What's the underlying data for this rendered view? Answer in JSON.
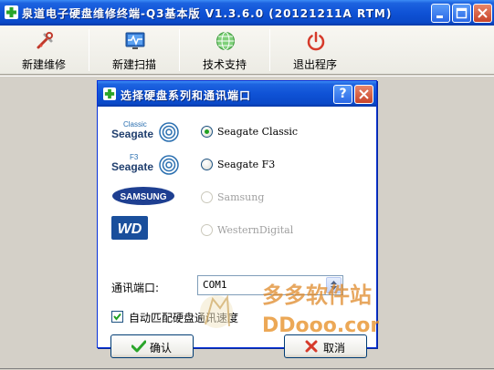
{
  "window": {
    "title": "泉道电子硬盘维修终端-Q3基本版  V1.3.6.0  (20121211A RTM)"
  },
  "toolbar": {
    "items": [
      {
        "label": "新建维修",
        "icon": "wrench-icon"
      },
      {
        "label": "新建扫描",
        "icon": "monitor-scan-icon"
      },
      {
        "label": "技术支持",
        "icon": "globe-icon"
      },
      {
        "label": "退出程序",
        "icon": "power-icon"
      }
    ]
  },
  "dialog": {
    "title": "选择硬盘系列和通讯端口",
    "help": "?",
    "series": [
      {
        "logo_text": "Seagate",
        "logo_sub": "Classic",
        "label": "Seagate Classic",
        "selected": true,
        "enabled": true
      },
      {
        "logo_text": "Seagate",
        "logo_sub": "F3",
        "label": "Seagate F3",
        "selected": false,
        "enabled": true
      },
      {
        "logo_text": "SAMSUNG",
        "label": "Samsung",
        "selected": false,
        "enabled": false
      },
      {
        "logo_text": "WD",
        "label": "WesternDigital",
        "selected": false,
        "enabled": false
      }
    ],
    "port_label": "通讯端口:",
    "port_value": "COM1",
    "auto_match_label": "自动匹配硬盘通讯速度",
    "auto_match_checked": true,
    "ok_label": "确认",
    "cancel_label": "取消"
  },
  "watermark": {
    "cn": "多多软件站",
    "en": "DDooo.com"
  },
  "colors": {
    "titlebar": "#0f52d6",
    "seagate_blue": "#2a6fb0",
    "samsung_blue": "#1e3f91",
    "wd_blue": "#1a4f9c",
    "radio_dot": "#21a121",
    "watermark_orange": "#d9822b"
  }
}
